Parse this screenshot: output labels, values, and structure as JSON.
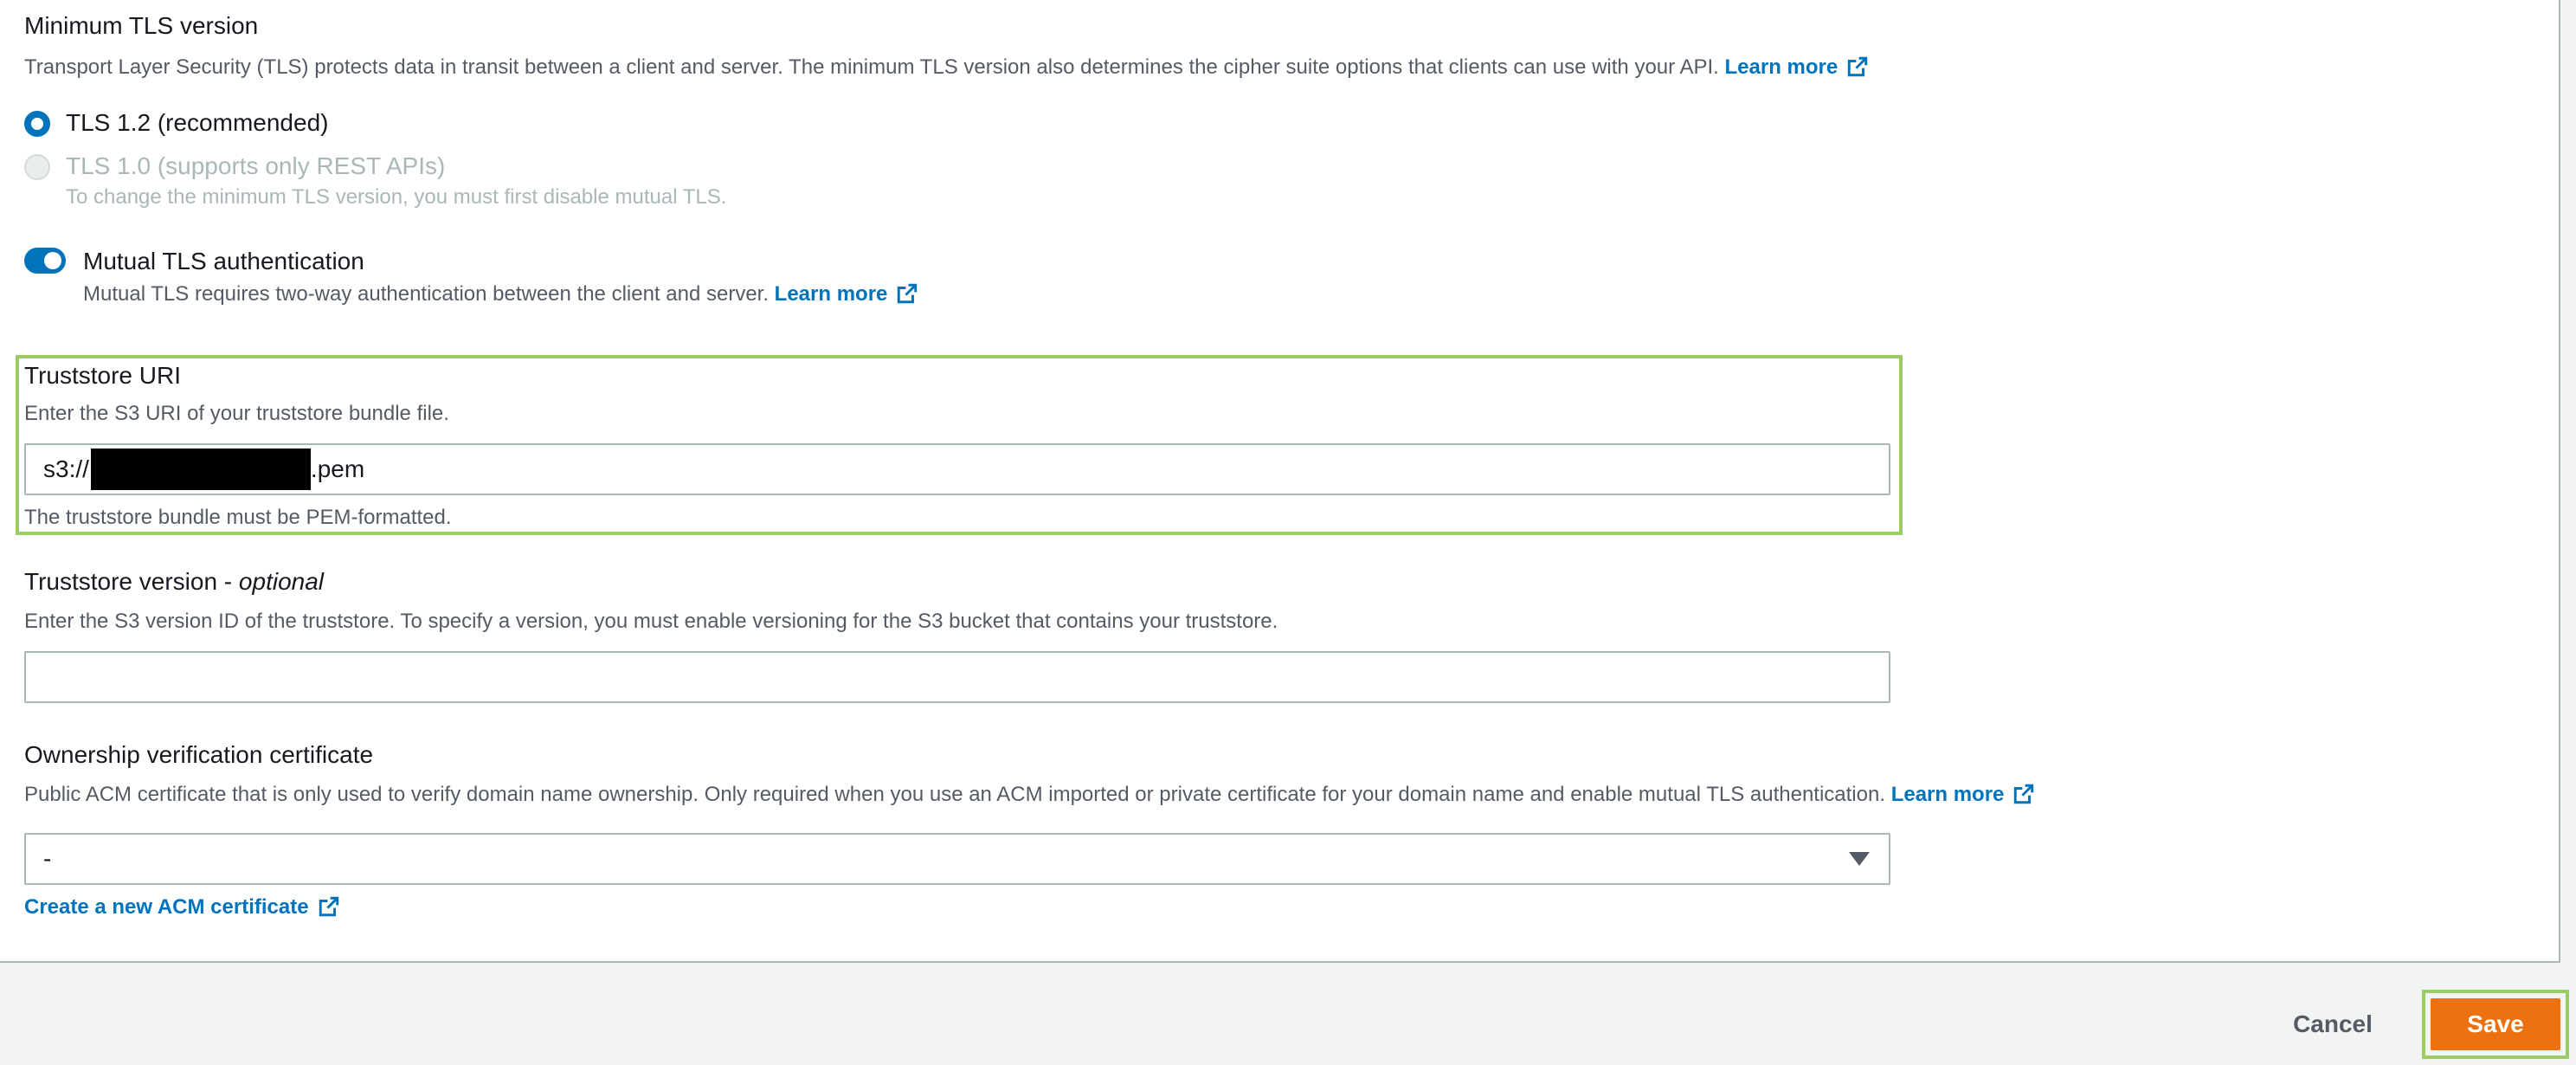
{
  "tls": {
    "title": "Minimum TLS version",
    "description": "Transport Layer Security (TLS) protects data in transit between a client and server. The minimum TLS version also determines the cipher suite options that clients can use with your API.",
    "learn_more": "Learn more",
    "options": [
      {
        "label": "TLS 1.2 (recommended)",
        "selected": true,
        "disabled": false
      },
      {
        "label": "TLS 1.0 (supports only REST APIs)",
        "selected": false,
        "disabled": true,
        "hint": "To change the minimum TLS version, you must first disable mutual TLS."
      }
    ]
  },
  "mutual_tls": {
    "label": "Mutual TLS authentication",
    "enabled": true,
    "description": "Mutual TLS requires two-way authentication between the client and server.",
    "learn_more": "Learn more"
  },
  "truststore_uri": {
    "label": "Truststore URI",
    "description": "Enter the S3 URI of your truststore bundle file.",
    "value_prefix": "s3://",
    "value_suffix": ".pem",
    "constraint": "The truststore bundle must be PEM-formatted."
  },
  "truststore_version": {
    "label": "Truststore version",
    "optional": "optional",
    "description": "Enter the S3 version ID of the truststore. To specify a version, you must enable versioning for the S3 bucket that contains your truststore.",
    "value": ""
  },
  "ownership": {
    "label": "Ownership verification certificate",
    "description": "Public ACM certificate that is only used to verify domain name ownership. Only required when you use an ACM imported or private certificate for your domain name and enable mutual TLS authentication.",
    "learn_more": "Learn more",
    "selected": "-",
    "create_link": "Create a new ACM certificate"
  },
  "footer": {
    "cancel": "Cancel",
    "save": "Save"
  },
  "colors": {
    "link": "#0073bb",
    "primary_button": "#ec7211",
    "highlight": "#9ccc65"
  }
}
